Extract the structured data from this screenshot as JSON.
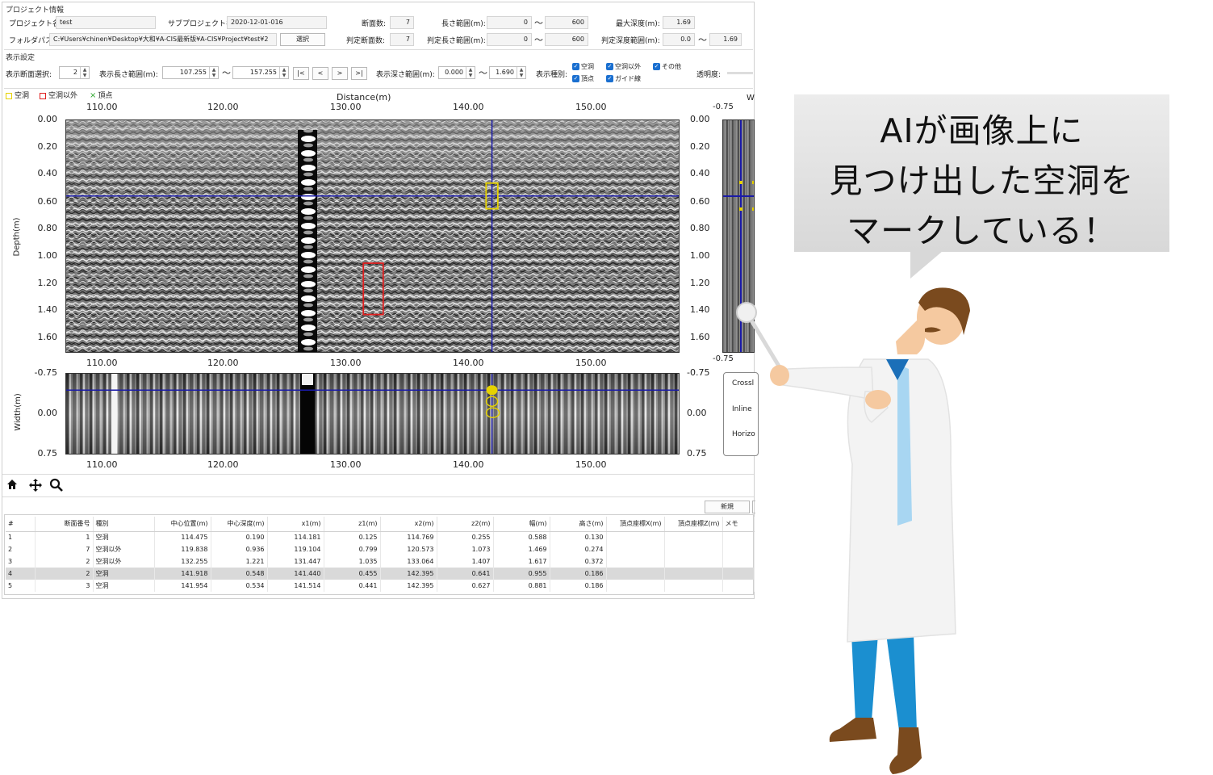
{
  "project_info": {
    "group_title": "プロジェクト情報",
    "project_name_label": "プロジェクト名:",
    "project_name": "test",
    "subproject_label": "サブプロジェクト名:",
    "subproject": "2020-12-01-016",
    "section_count_label": "断面数:",
    "section_count": "7",
    "length_range_label": "長さ範囲(m):",
    "length_min": "0",
    "length_max": "600",
    "max_depth_label": "最大深度(m):",
    "max_depth": "1.69",
    "folder_label": "フォルダパス:",
    "folder_path": "C:¥Users¥chinen¥Desktop¥大和¥A-CIS最新版¥A-CIS¥Project¥test¥2",
    "select_button": "選択",
    "judged_sections_label": "判定断面数:",
    "judged_sections": "7",
    "judged_length_label": "判定長さ範囲(m):",
    "judged_length_min": "0",
    "judged_length_max": "600",
    "judged_depth_label": "判定深度範囲(m):",
    "judged_depth_min": "0.0",
    "judged_depth_max": "1.69",
    "tilde": "〜"
  },
  "display_settings": {
    "group_title": "表示設定",
    "section_select_label": "表示断面選択:",
    "section_select": "2",
    "length_range_label": "表示長さ範囲(m):",
    "length_from": "107.255",
    "length_to": "157.255",
    "nav_first": "|<",
    "nav_prev": "<",
    "nav_next": ">",
    "nav_last": ">|",
    "depth_range_label": "表示深さ範囲(m):",
    "depth_from": "0.000",
    "depth_to": "1.690",
    "type_label": "表示種別:",
    "types": [
      "空洞",
      "空洞以外",
      "その他",
      "頂点",
      "ガイド線"
    ],
    "transparency_label": "透明度:"
  },
  "legend": {
    "cavity": "空洞",
    "non_cavity": "空洞以外",
    "apex": "頂点",
    "cavity_color": "#e6d200",
    "non_cavity_color": "#e02020",
    "apex_color": "#2aa52a"
  },
  "radar": {
    "xlabel": "Distance(m)",
    "ylabel_depth": "Depth(m)",
    "ylabel_width": "Width(m)",
    "x_ticks": [
      "110.00",
      "120.00",
      "130.00",
      "140.00",
      "150.00"
    ],
    "depth_ticks": [
      "0.00",
      "0.20",
      "0.40",
      "0.60",
      "0.80",
      "1.00",
      "1.20",
      "1.40",
      "1.60"
    ],
    "width_ticks": [
      "-0.75",
      "0.00",
      "0.75"
    ],
    "right_top": "-0.75",
    "right_bottom": "-0.75",
    "right_label_w": "W",
    "crossline": "Crossl",
    "inline": "Inline",
    "horizontal": "Horizo",
    "cursor_distance": 141.918,
    "cursor_depth": 0.548,
    "cursor_width": -0.45,
    "x_range": [
      107.255,
      157.255
    ],
    "depth_range": [
      0,
      1.69
    ],
    "width_range": [
      -0.75,
      0.75
    ],
    "guide_color": "#1a1aa8"
  },
  "toolbar_icons": [
    "home-icon",
    "pan-icon",
    "zoom-icon"
  ],
  "table": {
    "new_button": "新規",
    "columns": [
      "#",
      "断面番号",
      "種別",
      "中心位置(m)",
      "中心深度(m)",
      "x1(m)",
      "z1(m)",
      "x2(m)",
      "z2(m)",
      "幅(m)",
      "高さ(m)",
      "頂点座標X(m)",
      "頂点座標Z(m)",
      "メモ"
    ],
    "rows": [
      [
        "1",
        "1",
        "空洞",
        "114.475",
        "0.190",
        "114.181",
        "0.125",
        "114.769",
        "0.255",
        "0.588",
        "0.130",
        "",
        "",
        ""
      ],
      [
        "2",
        "7",
        "空洞以外",
        "119.838",
        "0.936",
        "119.104",
        "0.799",
        "120.573",
        "1.073",
        "1.469",
        "0.274",
        "",
        "",
        ""
      ],
      [
        "3",
        "2",
        "空洞以外",
        "132.255",
        "1.221",
        "131.447",
        "1.035",
        "133.064",
        "1.407",
        "1.617",
        "0.372",
        "",
        "",
        ""
      ],
      [
        "4",
        "2",
        "空洞",
        "141.918",
        "0.548",
        "141.440",
        "0.455",
        "142.395",
        "0.641",
        "0.955",
        "0.186",
        "",
        "",
        ""
      ],
      [
        "5",
        "3",
        "空洞",
        "141.954",
        "0.534",
        "141.514",
        "0.441",
        "142.395",
        "0.627",
        "0.881",
        "0.186",
        "",
        "",
        ""
      ]
    ],
    "selected_row": 3
  },
  "callout": {
    "lines": [
      "AIが画像上に",
      "見つけ出した空洞を",
      "マークしている！"
    ]
  }
}
